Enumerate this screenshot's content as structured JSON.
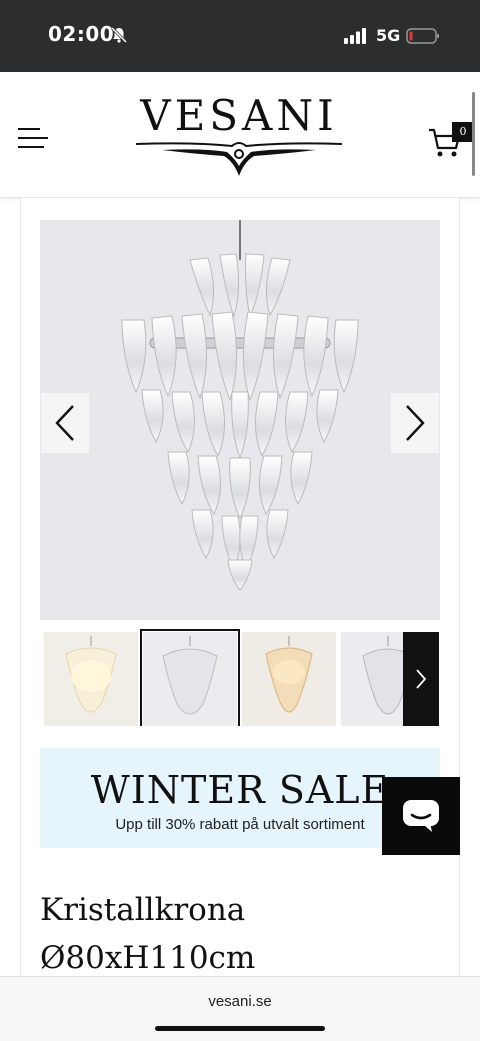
{
  "status_bar": {
    "time": "02:00",
    "network": "5G",
    "icons": [
      "bell-muted-icon",
      "signal-icon",
      "battery-icon"
    ]
  },
  "header": {
    "logo_text": "VESANI",
    "cart_count": "0",
    "icons": [
      "hamburger-menu-icon",
      "cart-icon"
    ]
  },
  "gallery": {
    "main_image": "crystal-chandelier-image",
    "prev_icon": "chevron-left-icon",
    "next_icon": "chevron-right-icon",
    "thumbnails": [
      {
        "name": "thumbnail-warm-lit"
      },
      {
        "name": "thumbnail-clear",
        "selected": true
      },
      {
        "name": "thumbnail-amber-lit"
      },
      {
        "name": "thumbnail-clear-side"
      }
    ]
  },
  "promo": {
    "title": "WINTER SALE",
    "subtitle": "Upp till 30% rabatt på utvalt sortiment"
  },
  "chat": {
    "icon": "chat-bubble-icon"
  },
  "product": {
    "title_line1": "Kristallkrona",
    "title_line2": "Ø80xH110cm"
  },
  "browser": {
    "url": "vesani.se"
  },
  "colors": {
    "status_bar_bg": "#2b2d2e",
    "promo_bg": "#e6f4fb",
    "accent_dark": "#111111"
  }
}
